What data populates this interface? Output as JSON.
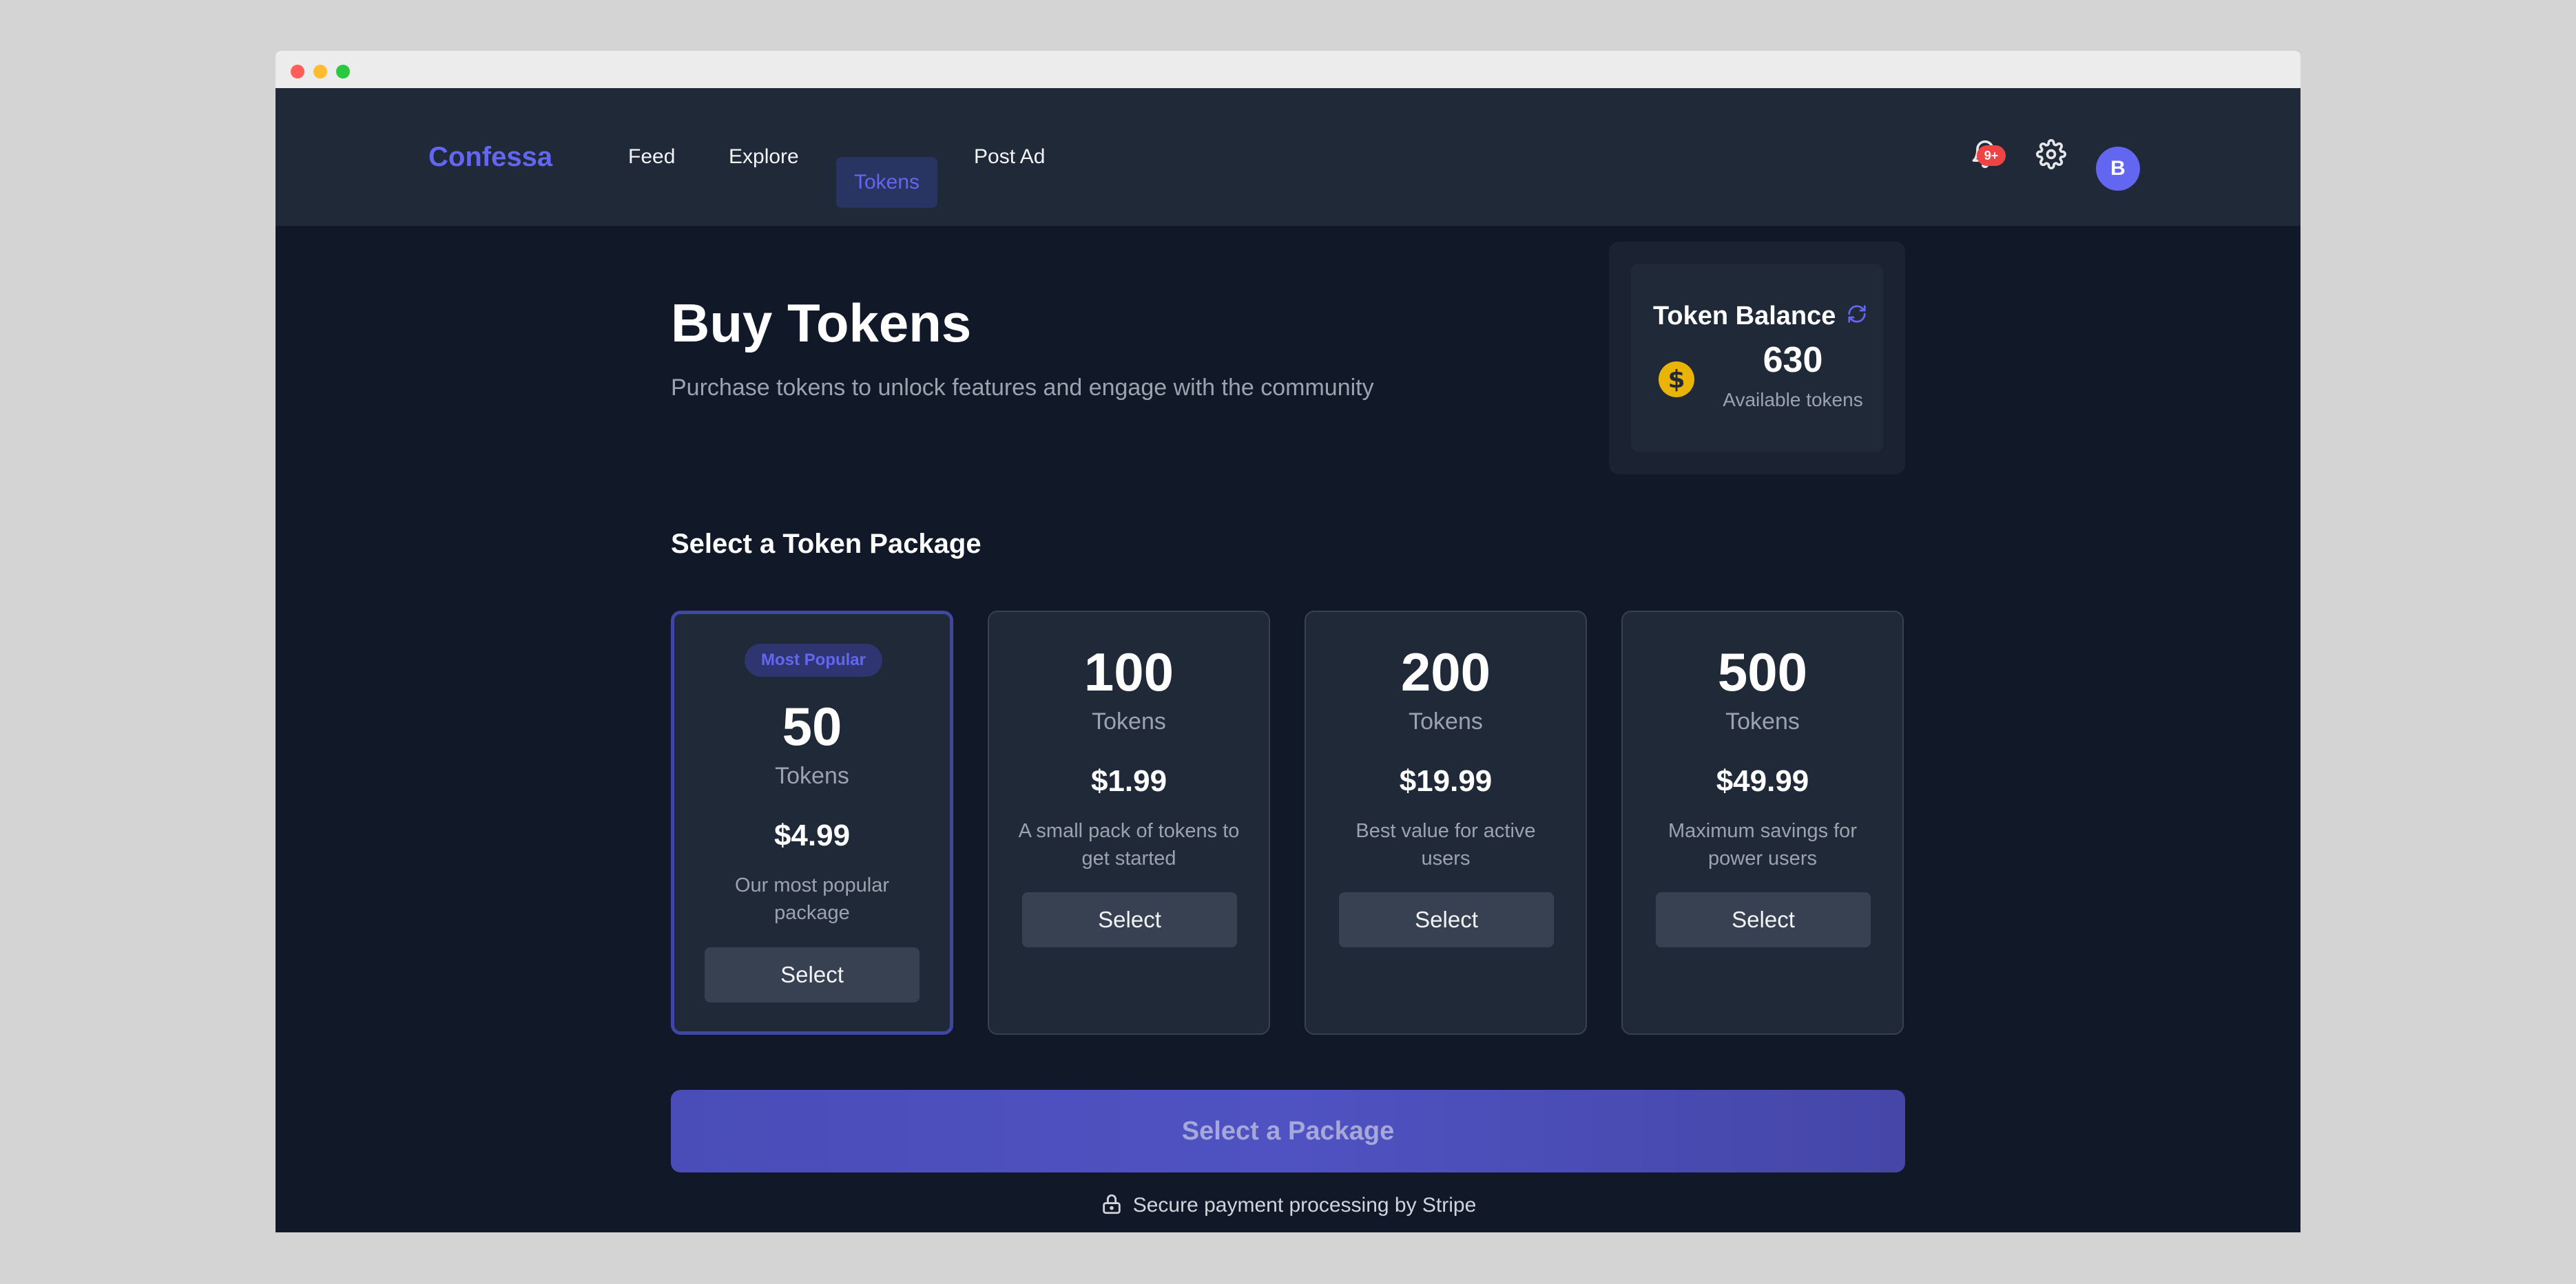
{
  "app": {
    "brand": "Confessa"
  },
  "nav": {
    "links": [
      {
        "label": "Feed"
      },
      {
        "label": "Explore"
      },
      {
        "label": "Tokens",
        "active": true
      },
      {
        "label": "Post Ad"
      }
    ],
    "notifications_badge": "9+",
    "avatar_initial": "B"
  },
  "header": {
    "title": "Buy Tokens",
    "subtitle": "Purchase tokens to unlock features and engage with the community"
  },
  "balance": {
    "title": "Token Balance",
    "value": "630",
    "label": "Available tokens"
  },
  "packages_section": {
    "title": "Select a Token Package",
    "packages": [
      {
        "badge": "Most Popular",
        "amount": "50",
        "unit": "Tokens",
        "price": "$4.99",
        "description": "Our most popular package",
        "button": "Select"
      },
      {
        "amount": "100",
        "unit": "Tokens",
        "price": "$1.99",
        "description": "A small pack of tokens to get started",
        "button": "Select"
      },
      {
        "amount": "200",
        "unit": "Tokens",
        "price": "$19.99",
        "description": "Best value for active users",
        "button": "Select"
      },
      {
        "amount": "500",
        "unit": "Tokens",
        "price": "$49.99",
        "description": "Maximum savings for power users",
        "button": "Select"
      }
    ]
  },
  "cta": {
    "label": "Select a Package"
  },
  "footer": {
    "secure_text": "Secure payment processing by Stripe"
  },
  "colors": {
    "accent": "#6366f1",
    "background": "#111827",
    "card": "#1f2937",
    "badge": "#ef4444",
    "coin": "#eab308"
  },
  "icons": [
    "bell-icon",
    "gear-icon",
    "refresh-icon",
    "coin-icon",
    "lock-icon"
  ]
}
